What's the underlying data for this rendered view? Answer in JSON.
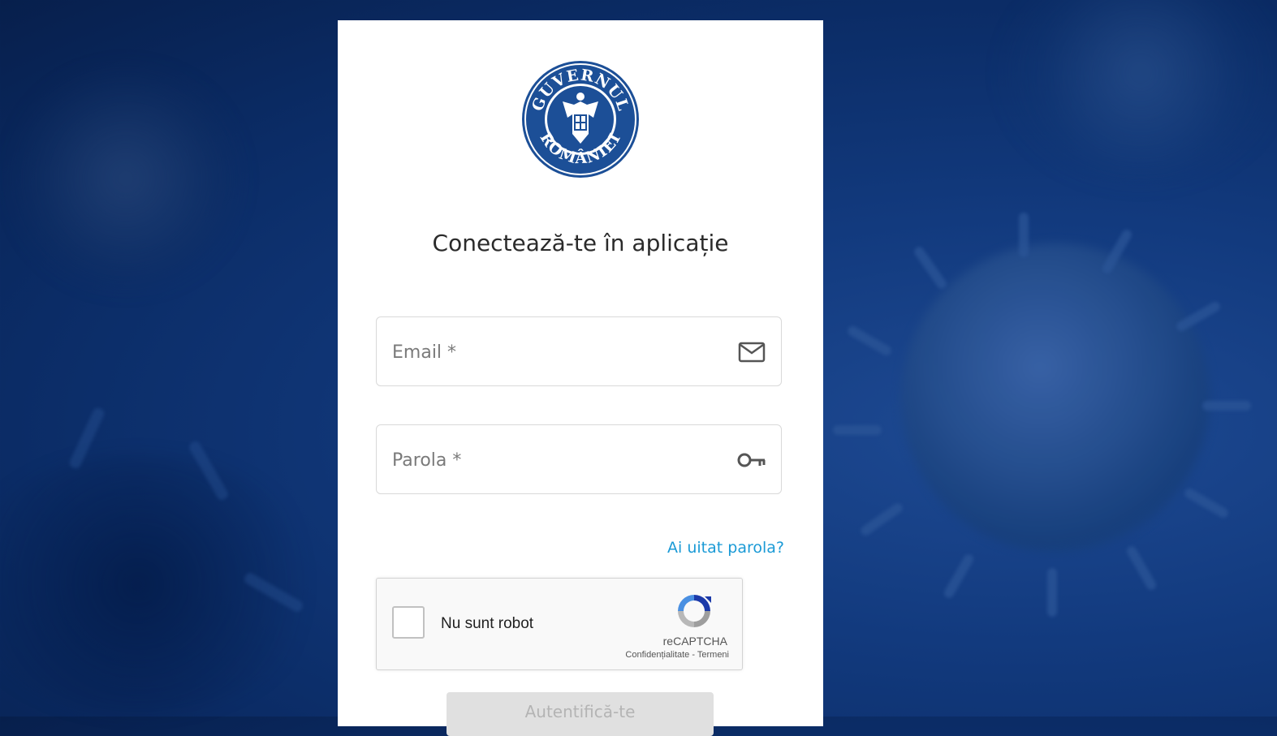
{
  "logo": {
    "top_text": "GUVERNUL",
    "bottom_text": "ROMÂNIEI",
    "icon": "government-seal-icon"
  },
  "page": {
    "title": "Conectează-te în aplicație"
  },
  "form": {
    "email": {
      "placeholder": "Email *",
      "value": "",
      "icon": "mail-icon"
    },
    "password": {
      "placeholder": "Parola *",
      "value": "",
      "icon": "key-icon"
    },
    "forgot_link": "Ai uitat parola?",
    "submit_label": "Autentifică-te"
  },
  "captcha": {
    "label": "Nu sunt robot",
    "brand": "reCAPTCHA",
    "privacy": "Confidențialitate",
    "separator": " - ",
    "terms": "Termeni",
    "checked": false
  },
  "colors": {
    "accent": "#1a9ad6",
    "seal_blue": "#1c4f97",
    "background": "#0b2c66"
  }
}
